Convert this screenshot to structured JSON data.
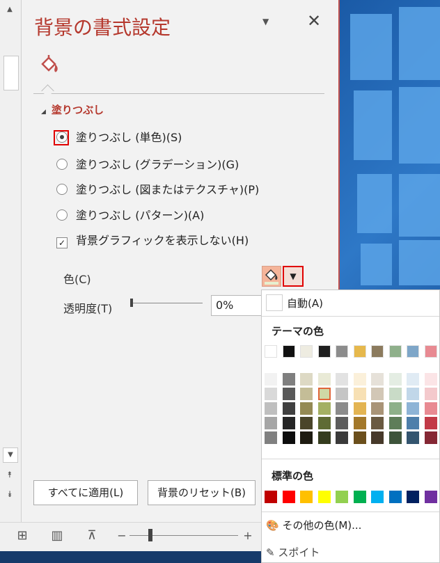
{
  "panel": {
    "title": "背景の書式設定",
    "section": "塗りつぶし",
    "options": [
      "塗りつぶし (単色)(S)",
      "塗りつぶし (グラデーション)(G)",
      "塗りつぶし (図またはテクスチャ)(P)",
      "塗りつぶし (パターン)(A)"
    ],
    "hide_graphics": "背景グラフィックを表示しない(H)",
    "color_label": "色(C)",
    "transparency_label": "透明度(T)",
    "transparency_value": "0%",
    "apply_all": "すべてに適用(L)",
    "reset": "背景のリセット(B)"
  },
  "popup": {
    "auto": "自動(A)",
    "theme_title": "テーマの色",
    "standard_title": "標準の色",
    "more_colors": "その他の色(M)...",
    "eyedropper": "スポイト",
    "theme_top": [
      "#ffffff",
      "#111111",
      "#eeece1",
      "#1f1f1f",
      "#8c8c8c",
      "#e6b84c",
      "#8c7b5e",
      "#8fb08b",
      "#7ea6c8",
      "#e88a92"
    ],
    "theme_shades": [
      [
        "#f2f2f2",
        "#d9d9d9",
        "#bfbfbf",
        "#a6a6a6",
        "#808080"
      ],
      [
        "#7f7f7f",
        "#595959",
        "#404040",
        "#262626",
        "#0d0d0d"
      ],
      [
        "#ddd9c4",
        "#c4bd97",
        "#948a54",
        "#4a452a",
        "#1e1c11"
      ],
      [
        "#e9ead6",
        "#cfd8a6",
        "#a4b063",
        "#5f6b34",
        "#353c1e"
      ],
      [
        "#e2e2e2",
        "#c5c5c5",
        "#8b8b8b",
        "#5c5c5c",
        "#3a3a3a"
      ],
      [
        "#fbf0da",
        "#f7e0b4",
        "#e3b452",
        "#a3782a",
        "#6b4f1c"
      ],
      [
        "#e6e1d9",
        "#d2c7b6",
        "#a99477",
        "#6a5a41",
        "#47392a"
      ],
      [
        "#e4ede3",
        "#c9dbc7",
        "#8eb08a",
        "#5e7d59",
        "#3e543b"
      ],
      [
        "#e0ebf4",
        "#c1d7e9",
        "#8eb4d6",
        "#4e7faa",
        "#34556f"
      ],
      [
        "#fbe4e6",
        "#f4c9cc",
        "#e88a92",
        "#c23a47",
        "#852834"
      ]
    ],
    "standard": [
      "#c00000",
      "#ff0000",
      "#ffc000",
      "#ffff00",
      "#92d050",
      "#00b050",
      "#00b0f0",
      "#0070c0",
      "#002060",
      "#7030a0"
    ]
  },
  "statusbar": {
    "minus": "−",
    "plus": "+"
  }
}
